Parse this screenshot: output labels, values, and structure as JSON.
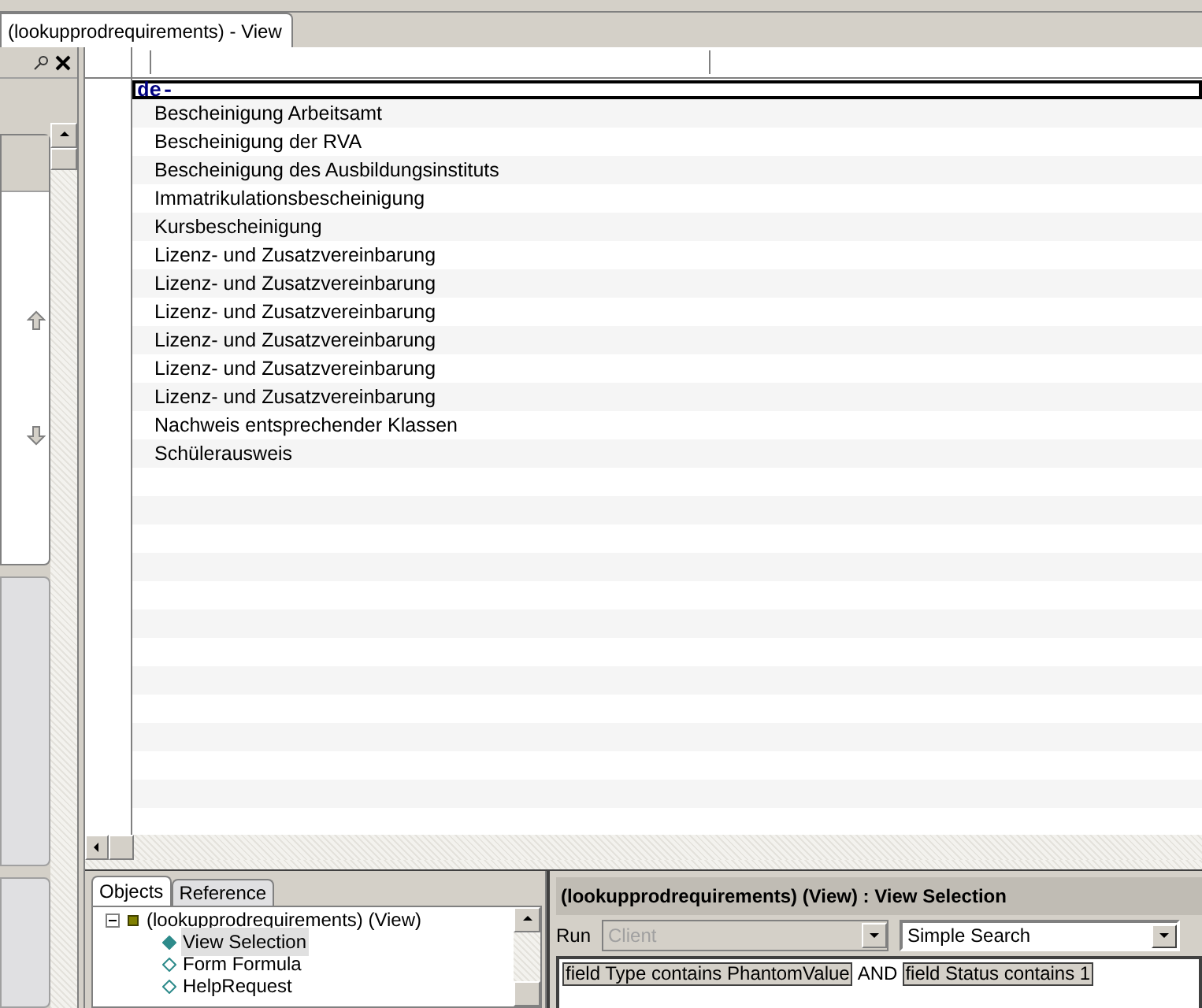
{
  "tab": {
    "title": "(lookupprodrequirements) - View"
  },
  "view": {
    "category": "de-",
    "rows": [
      "Bescheinigung Arbeitsamt",
      "Bescheinigung der RVA",
      "Bescheinigung des Ausbildungsinstituts",
      "Immatrikulationsbescheinigung",
      "Kursbescheinigung",
      "Lizenz- und Zusatzvereinbarung",
      "Lizenz- und Zusatzvereinbarung",
      "Lizenz- und Zusatzvereinbarung",
      "Lizenz- und Zusatzvereinbarung",
      "Lizenz- und Zusatzvereinbarung",
      "Lizenz- und Zusatzvereinbarung",
      "Nachweis entsprechender Klassen",
      "Schülerausweis"
    ]
  },
  "objects_panel": {
    "tabs": [
      {
        "label": "Objects",
        "selected": true
      },
      {
        "label": "Reference",
        "selected": false
      }
    ],
    "tree": [
      {
        "label": "(lookupprodrequirements) (View)",
        "expanded": true,
        "children": [
          {
            "label": "View Selection",
            "selected": true
          },
          {
            "label": "Form Formula",
            "selected": false
          },
          {
            "label": "HelpRequest",
            "selected": false
          }
        ]
      }
    ]
  },
  "selection_panel": {
    "title": "(lookupprodrequirements) (View) : View Selection",
    "run_label": "Run",
    "run_target": {
      "value": "Client",
      "disabled": true
    },
    "search_type": "Simple Search",
    "conditions": [
      {
        "kind": "term",
        "text": "field Type contains PhantomValue"
      },
      {
        "kind": "operator",
        "text": "AND"
      },
      {
        "kind": "term",
        "text": "field Status contains 1"
      }
    ]
  }
}
